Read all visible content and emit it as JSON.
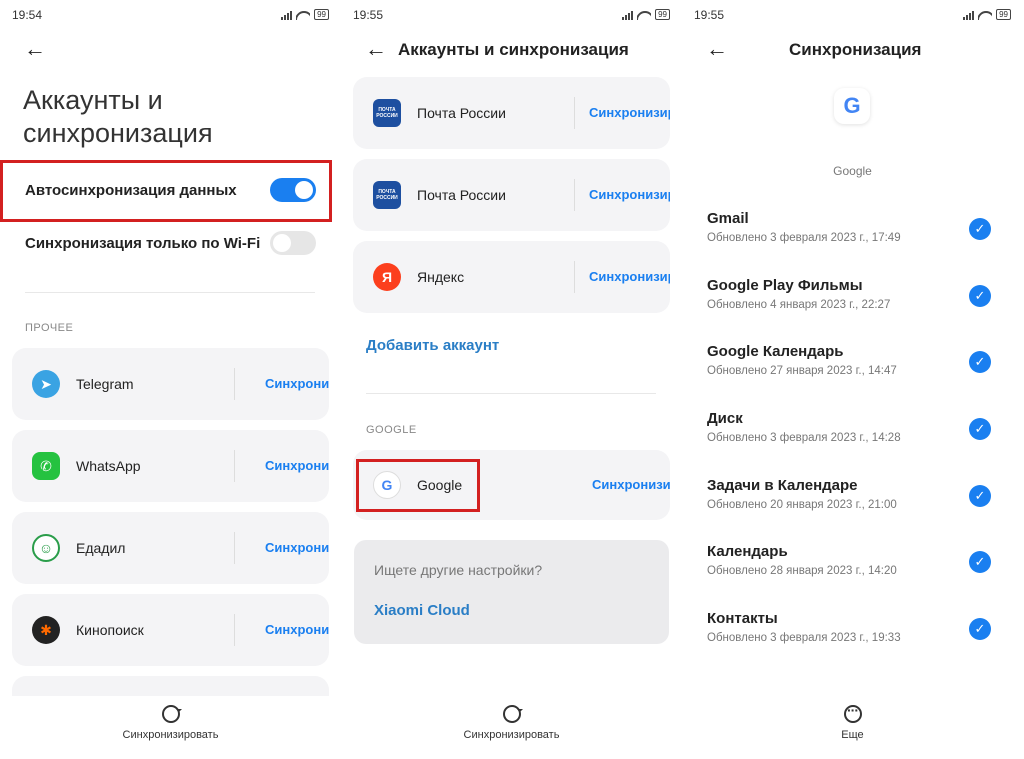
{
  "panels": [
    {
      "status_time": "19:54",
      "battery": "99",
      "title": "Аккаунты и синхронизация",
      "auto_sync_label": "Автосинхронизация данных",
      "wifi_only_label": "Синхронизация только по Wi-Fi",
      "section_other": "ПРОЧЕЕ",
      "accounts": [
        {
          "name": "Telegram",
          "sync": "Синхрони",
          "icon": "telegram-icon",
          "color": "#3aa3e3"
        },
        {
          "name": "WhatsApp",
          "sync": "Синхрони",
          "icon": "whatsapp-icon",
          "color": "#25c240"
        },
        {
          "name": "Едадил",
          "sync": "Синхрони",
          "icon": "edadil-icon",
          "color": "#2a9d4a"
        },
        {
          "name": "Кинопоиск",
          "sync": "Синхрони",
          "icon": "kinopoisk-icon",
          "color": "#222222"
        }
      ],
      "bottom_label": "Синхронизировать"
    },
    {
      "status_time": "19:55",
      "battery": "99",
      "title": "Аккаунты и синхронизация",
      "accounts": [
        {
          "name": "Почта России",
          "sync": "Синхронизиро",
          "icon": "pochta-icon",
          "icon_text": "ПОЧТА РОССИИ",
          "color": "#1d4fa0"
        },
        {
          "name": "Почта России",
          "sync": "Синхронизиро",
          "icon": "pochta-icon",
          "icon_text": "ПОЧТА РОССИИ",
          "color": "#1d4fa0"
        },
        {
          "name": "Яндекс",
          "sync": "Синхронизиро",
          "icon": "yandex-icon",
          "icon_text": "Я",
          "color": "#fc3f1d"
        }
      ],
      "add_account": "Добавить аккаунт",
      "section_google": "GOOGLE",
      "google_account": {
        "name": "Google",
        "sync": "Синхронизиро"
      },
      "other_settings": "Ищете другие настройки?",
      "xiaomi_cloud": "Xiaomi Cloud",
      "bottom_label": "Синхронизировать"
    },
    {
      "status_time": "19:55",
      "battery": "99",
      "title": "Синхронизация",
      "account_label": "Google",
      "items": [
        {
          "name": "Gmail",
          "updated": "Обновлено 3 февраля 2023 г., 17:49"
        },
        {
          "name": "Google Play Фильмы",
          "updated": "Обновлено 4 января 2023 г., 22:27"
        },
        {
          "name": "Google Календарь",
          "updated": "Обновлено 27 января 2023 г., 14:47"
        },
        {
          "name": "Диск",
          "updated": "Обновлено 3 февраля 2023 г., 14:28"
        },
        {
          "name": "Задачи в Календаре",
          "updated": "Обновлено 20 января 2023 г., 21:00"
        },
        {
          "name": "Календарь",
          "updated": "Обновлено 28 января 2023 г., 14:20"
        },
        {
          "name": "Контакты",
          "updated": "Обновлено 3 февраля 2023 г., 19:33"
        }
      ],
      "bottom_label": "Еще"
    }
  ],
  "colors": {
    "accent": "#1a7ff0",
    "highlight": "#d32020",
    "link": "#2a7ec6"
  }
}
